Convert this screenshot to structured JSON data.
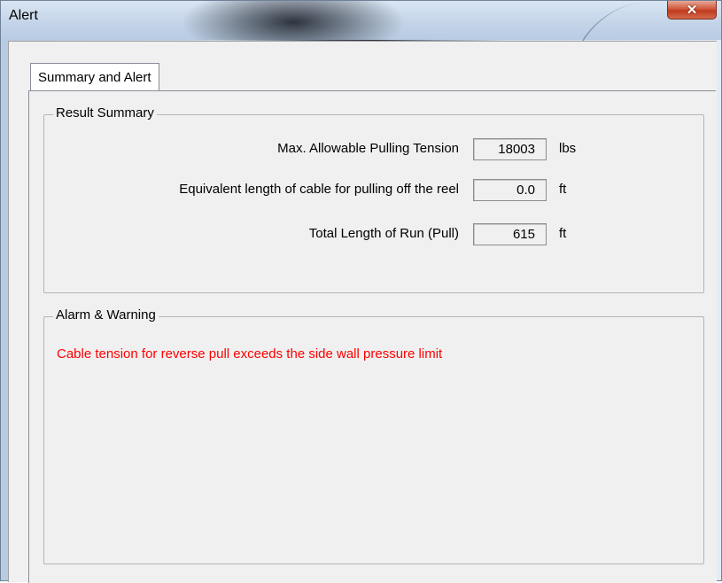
{
  "window": {
    "title": "Alert",
    "close_glyph": "✕"
  },
  "tabs": [
    {
      "label": "Summary and Alert",
      "selected": true
    }
  ],
  "result_summary": {
    "legend": "Result Summary",
    "rows": [
      {
        "label": "Max. Allowable Pulling Tension",
        "value": "18003",
        "unit": "lbs"
      },
      {
        "label": "Equivalent length of cable for pulling off the reel",
        "value": "0.0",
        "unit": "ft"
      },
      {
        "label": "Total Length of Run (Pull)",
        "value": "615",
        "unit": "ft"
      }
    ]
  },
  "alarm_warning": {
    "legend": "Alarm & Warning",
    "messages": [
      {
        "text": "Cable tension for reverse pull exceeds the side wall pressure limit",
        "color": "#ff0000"
      }
    ]
  },
  "colors": {
    "dialog_background": "#f0f0f0",
    "alert_text": "#ff0000",
    "close_button": "#c1391d"
  }
}
